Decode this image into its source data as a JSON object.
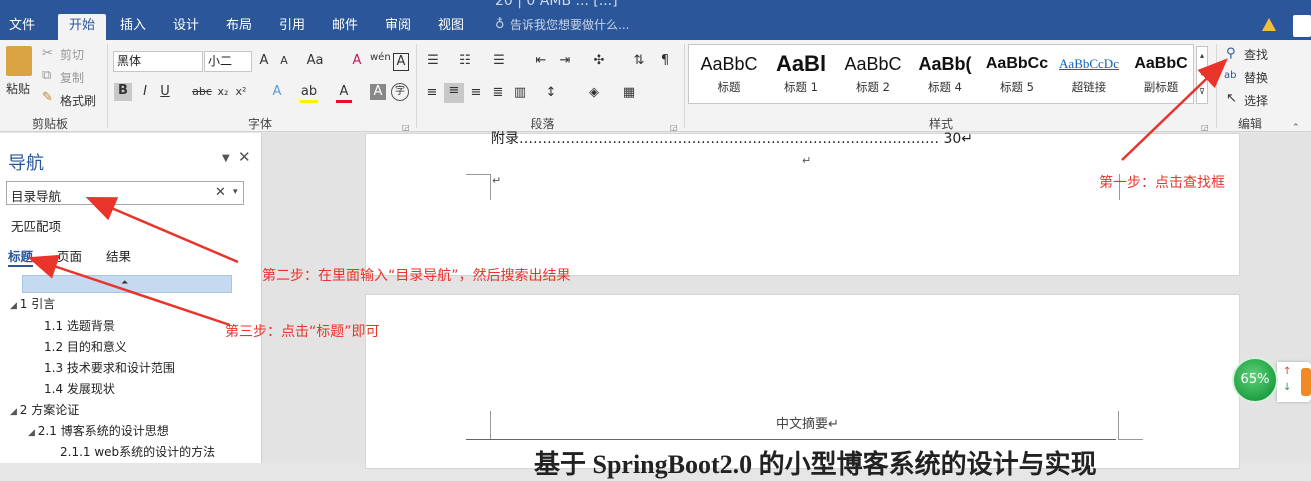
{
  "window": {
    "title_partial": "20 | 0     AMB ... [...]"
  },
  "tabs": [
    {
      "label": "文件"
    },
    {
      "label": "开始",
      "active": true
    },
    {
      "label": "插入"
    },
    {
      "label": "设计"
    },
    {
      "label": "布局"
    },
    {
      "label": "引用"
    },
    {
      "label": "邮件"
    },
    {
      "label": "审阅"
    },
    {
      "label": "视图"
    }
  ],
  "tellme": "告诉我您想要做什么...",
  "clipboard": {
    "paste": "粘贴",
    "cut": "剪切",
    "copy": "复制",
    "format_painter": "格式刷",
    "group": "剪贴板"
  },
  "font": {
    "name": "黑体",
    "size": "小二",
    "group": "字体"
  },
  "paragraph": {
    "group": "段落"
  },
  "styles": {
    "group": "样式",
    "items": [
      {
        "preview": "AaBbC",
        "name": "标题"
      },
      {
        "preview": "AaBl",
        "name": "标题 1"
      },
      {
        "preview": "AaBbC",
        "name": "标题 2"
      },
      {
        "preview": "AaBb(",
        "name": "标题 4"
      },
      {
        "preview": "AaBbCc",
        "name": "标题 5"
      },
      {
        "preview": "AaBbCcDc",
        "name": "超链接"
      },
      {
        "preview": "AaBbC",
        "name": "副标题"
      }
    ]
  },
  "editing": {
    "find": "查找",
    "replace": "替换",
    "select": "选择",
    "group": "编辑"
  },
  "nav": {
    "title": "导航",
    "search": "目录导航",
    "nomatch": "无匹配项",
    "tabs": [
      "标题",
      "页面",
      "结果"
    ],
    "tree": [
      {
        "text": "1  引言",
        "lvl": 1,
        "exp": true
      },
      {
        "text": "1.1  选题背景",
        "lvl": 2
      },
      {
        "text": "1.2  目的和意义",
        "lvl": 2
      },
      {
        "text": "1.3 技术要求和设计范围",
        "lvl": 2
      },
      {
        "text": "1.4  发展现状",
        "lvl": 2
      },
      {
        "text": "2 方案论证",
        "lvl": 1,
        "exp": true
      },
      {
        "text": "2.1 博客系统的设计思想",
        "lvl": 2,
        "exp": true
      },
      {
        "text": "2.1.1 web系统的设计的方法",
        "lvl": 3
      }
    ]
  },
  "doc": {
    "toc_line": "附录……………………………………………………………………………… 30↵",
    "para1": "↵",
    "para2": "↵",
    "header": "中文摘要↵",
    "title": "基于 SpringBoot2.0 的小型博客系统的设计与实现"
  },
  "annotations": {
    "step1": "第一步：点击查找框",
    "step2": "第二步：在里面输入“目录导航”，然后搜索出结果",
    "step3": "第三步：点击“标题”即可"
  },
  "zoom": "65%",
  "colors": {
    "accent": "#2b579a",
    "annotation": "#e8342b",
    "zoom": "#1fa043"
  }
}
